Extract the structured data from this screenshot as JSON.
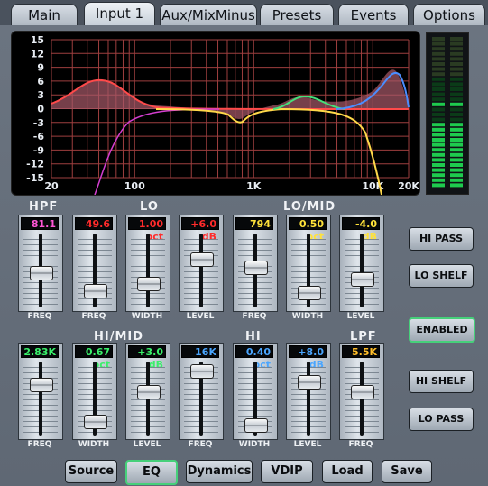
{
  "tabs": [
    {
      "label": "Main",
      "active": false
    },
    {
      "label": "Input 1",
      "active": true
    },
    {
      "label": "Aux/MixMinus",
      "active": false
    },
    {
      "label": "Presets",
      "active": false
    },
    {
      "label": "Events",
      "active": false
    },
    {
      "label": "Options",
      "active": false
    }
  ],
  "graph": {
    "y_ticks": [
      "15",
      "12",
      "9",
      "6",
      "3",
      "0",
      "-3",
      "-6",
      "-9",
      "-12",
      "-15"
    ],
    "x_ticks": [
      "20",
      "100",
      "1K",
      "10K",
      "20K"
    ]
  },
  "sections": {
    "hpf": "HPF",
    "lo": "LO",
    "lo_mid": "LO/MID",
    "hi_mid": "HI/MID",
    "hi": "HI",
    "lpf": "LPF"
  },
  "row1": [
    {
      "value": "81.1",
      "color": "#ff57d6",
      "label": "FREQ",
      "level": 0.45
    },
    {
      "value": "49.6",
      "color": "#ff2b2b",
      "label": "FREQ",
      "level": 0.15
    },
    {
      "value": "1.00 oct",
      "color": "#ff2b2b",
      "label": "WIDTH",
      "level": 0.28
    },
    {
      "value": "+6.0 dB",
      "color": "#ff2b2b",
      "label": "LEVEL",
      "level": 0.68
    },
    {
      "value": "794",
      "color": "#ffe23a",
      "label": "FREQ",
      "level": 0.55
    },
    {
      "value": "0.50 oct",
      "color": "#ffe23a",
      "label": "WIDTH",
      "level": 0.12
    },
    {
      "value": "-4.0 dB",
      "color": "#ffe23a",
      "label": "LEVEL",
      "level": 0.35
    }
  ],
  "row2": [
    {
      "value": "2.83K",
      "color": "#39f06a",
      "label": "FREQ",
      "level": 0.73
    },
    {
      "value": "0.67 oct",
      "color": "#39f06a",
      "label": "WIDTH",
      "level": 0.1
    },
    {
      "value": "+3.0 dB",
      "color": "#39f06a",
      "label": "LEVEL",
      "level": 0.6
    },
    {
      "value": "16K",
      "color": "#4aa6ff",
      "label": "FREQ",
      "level": 0.95
    },
    {
      "value": "0.40 oct",
      "color": "#4aa6ff",
      "label": "WIDTH",
      "level": 0.05
    },
    {
      "value": "+8.0 dB",
      "color": "#4aa6ff",
      "label": "LEVEL",
      "level": 0.78
    },
    {
      "value": "5.5K",
      "color": "#ffbe2a",
      "label": "FREQ",
      "level": 0.6
    }
  ],
  "right_buttons": {
    "hi_pass": "HI PASS",
    "lo_shelf": "LO SHELF",
    "enabled": "ENABLED",
    "hi_shelf": "HI SHELF",
    "lo_pass": "LO PASS"
  },
  "bottom_buttons": [
    {
      "label": "Source",
      "active": false
    },
    {
      "label": "EQ",
      "active": true
    },
    {
      "label": "Dynamics",
      "active": false
    },
    {
      "label": "VDIP",
      "active": false
    },
    {
      "label": "Load",
      "active": false
    },
    {
      "label": "Save",
      "active": false
    }
  ],
  "colors": {
    "red_curve": "#ff4a4a",
    "yellow_curve": "#ffd84a",
    "green_curve": "#44e07a",
    "blue_curve": "#4a8dff",
    "magenta_curve": "#d43ed0",
    "grid": "#c05050"
  }
}
